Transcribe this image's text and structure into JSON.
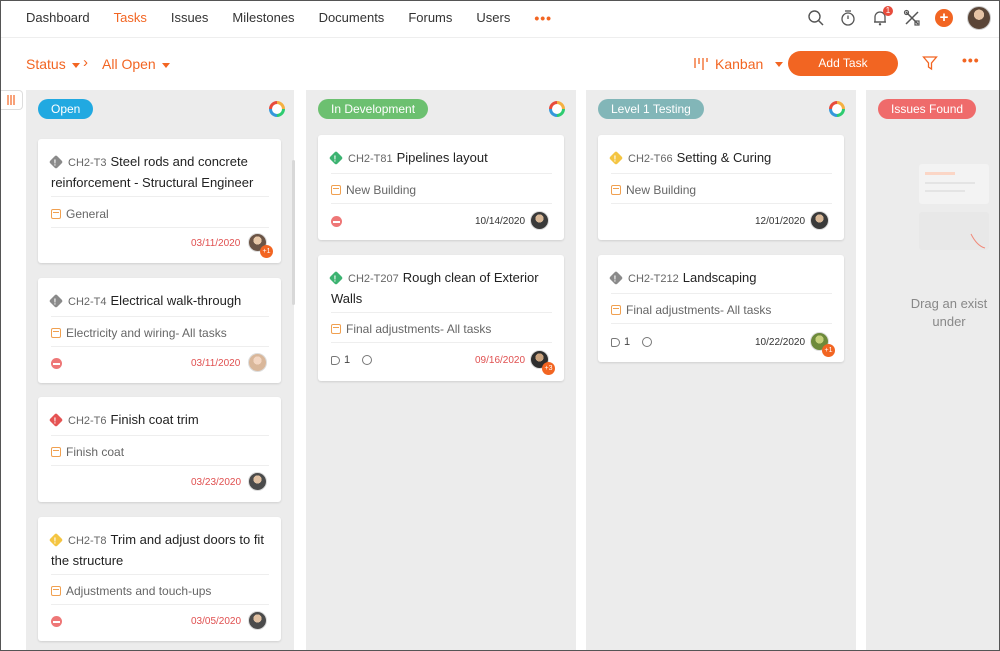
{
  "nav": {
    "items": [
      "Dashboard",
      "Tasks",
      "Issues",
      "Milestones",
      "Documents",
      "Forums",
      "Users"
    ],
    "active": "Tasks",
    "more": "•••",
    "notification_count": "1",
    "plus": "+"
  },
  "toolbar": {
    "status_label": "Status",
    "view_filter": "All Open",
    "layout_label": "Kanban",
    "add_task": "Add Task",
    "more": "•••"
  },
  "columns": [
    {
      "title": "Open",
      "color": "#21a9e1",
      "cards": [
        {
          "priority": "grey",
          "id": "CH2-T3",
          "title": "Steel rods and concrete reinforcement - Structural Engineer",
          "tasklist": "General",
          "date": "03/11/2020",
          "overdue": true,
          "plus": "+1",
          "status": ""
        },
        {
          "priority": "grey",
          "id": "CH2-T4",
          "title": "Electrical walk-through",
          "tasklist": "Electricity and wiring- All tasks",
          "date": "03/11/2020",
          "overdue": true,
          "plus": "",
          "status": "minus"
        },
        {
          "priority": "red",
          "id": "CH2-T6",
          "title": "Finish coat trim",
          "tasklist": "Finish coat",
          "date": "03/23/2020",
          "overdue": true,
          "plus": "",
          "status": ""
        },
        {
          "priority": "yellow",
          "id": "CH2-T8",
          "title": "Trim and adjust doors to fit the structure",
          "tasklist": "Adjustments and touch-ups",
          "date": "03/05/2020",
          "overdue": true,
          "plus": "",
          "status": "minus"
        }
      ]
    },
    {
      "title": "In Development",
      "color": "#6cc070",
      "cards": [
        {
          "priority": "green",
          "id": "CH2-T81",
          "title": "Pipelines layout",
          "tasklist": "New Building",
          "date": "10/14/2020",
          "overdue": false,
          "plus": "",
          "status": "minus"
        },
        {
          "priority": "green",
          "id": "CH2-T207",
          "title": "Rough clean of Exterior Walls",
          "tasklist": "Final adjustments- All tasks",
          "date": "09/16/2020",
          "overdue": true,
          "plus": "+3",
          "tags": "1",
          "status": ""
        }
      ]
    },
    {
      "title": "Level 1 Testing",
      "color": "#82b6b8",
      "cards": [
        {
          "priority": "yellow",
          "id": "CH2-T66",
          "title": "Setting & Curing",
          "tasklist": "New Building",
          "date": "12/01/2020",
          "overdue": false,
          "plus": "",
          "status": ""
        },
        {
          "priority": "grey",
          "id": "CH2-T212",
          "title": "Landscaping",
          "tasklist": "Final adjustments- All tasks",
          "date": "10/22/2020",
          "overdue": false,
          "plus": "+1",
          "tags": "1",
          "status": ""
        }
      ]
    },
    {
      "title": "Issues Found",
      "color": "#ef6b6b",
      "empty_text_1": "Drag an exist",
      "empty_text_2": "under"
    }
  ]
}
